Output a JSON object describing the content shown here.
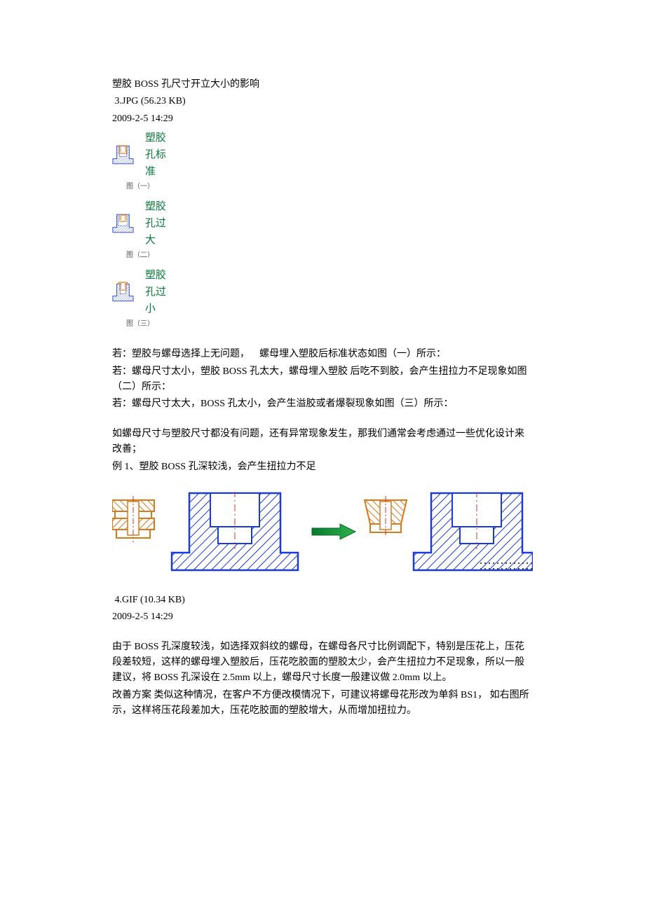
{
  "line1": "塑胶 BOSS 孔尺寸开立大小的影响",
  "file1": " 3.JPG (56.23 KB)",
  "time1": "2009-2-5 14:29",
  "fig": {
    "label1": "塑胶孔标准",
    "cap1": "图（一）",
    "label2": "塑胶孔过大",
    "cap2": "图（二）",
    "label3": "塑胶孔过小",
    "cap3": "图（三）"
  },
  "para1": "若：塑胶与螺母选择上无问题， 螺母埋入塑胶后标准状态如图（一）所示：",
  "para2": "若：螺母尺寸太小，塑胶 BOSS 孔太大，螺母埋入塑胶 后吃不到胶，会产生扭拉力不足现象如图（二）所示：",
  "para3": "若：螺母尺寸太大，BOSS 孔太小，会产生溢胶或者爆裂现象如图（三）所示：",
  "para4": "如螺母尺寸与塑胶尺寸都没有问题，还有异常现象发生，那我们通常会考虑通过一些优化设计来改善；",
  "para5": "例 1、塑胶 BOSS 孔深较浅，会产生扭拉力不足",
  "file2": " 4.GIF (10.34 KB)",
  "time2": "2009-2-5 14:29",
  "para6": "由于 BOSS 孔深度较浅，如选择双斜纹的螺母，在螺母各尺寸比例调配下，特别是压花上，压花段差较短，这样的螺母埋入塑胶后，压花吃胶面的塑胶太少，会产生扭拉力不足现象，所以一般建议，将 BOSS 孔深设在 2.5mm 以上，螺母尺寸长度一般建议做 2.0mm 以上。",
  "para7": "改善方案 类似这种情况，在客户不方便改模情况下，可建议将螺母花形改为单斜 BS1， 如右图所示，这样将压花段差加大，压花吃胶面的塑胶增大，从而增加扭拉力。"
}
